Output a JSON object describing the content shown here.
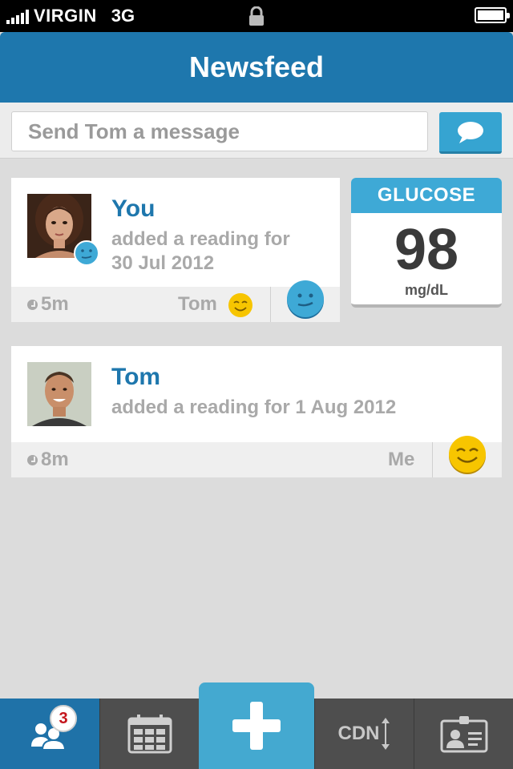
{
  "status_bar": {
    "carrier": "VIRGIN",
    "network": "3G",
    "icons": [
      "signal-bars-icon",
      "lock-icon",
      "battery-icon"
    ]
  },
  "header": {
    "title": "Newsfeed"
  },
  "message_bar": {
    "placeholder": "Send Tom a message",
    "send_icon": "speech-bubble-icon"
  },
  "feed": [
    {
      "author": "You",
      "action": "added a reading for",
      "date": "30 Jul 2012",
      "time_ago": "5m",
      "reactor": "Tom",
      "reactor_emoji": "smile-icon",
      "my_mood": "neutral-face-icon",
      "avatar_mood": "neutral-face-icon"
    },
    {
      "author": "Tom",
      "action": "added a reading for 1 Aug 2012",
      "time_ago": "8m",
      "reactor": "Me",
      "my_mood": "smile-icon"
    }
  ],
  "glucose": {
    "label": "GLUCOSE",
    "value": "98",
    "unit": "mg/dL"
  },
  "tab_bar": {
    "tabs": [
      {
        "icon": "people-icon",
        "badge": "3",
        "active": true
      },
      {
        "icon": "calendar-icon"
      },
      {
        "icon": "plus-icon"
      },
      {
        "icon": "cdn-icon",
        "label": "CDN"
      },
      {
        "icon": "id-card-icon"
      }
    ]
  },
  "colors": {
    "primary": "#1e77ad",
    "accent": "#3ea9d6",
    "smile": "#f7c500",
    "badge": "#c4141b"
  }
}
